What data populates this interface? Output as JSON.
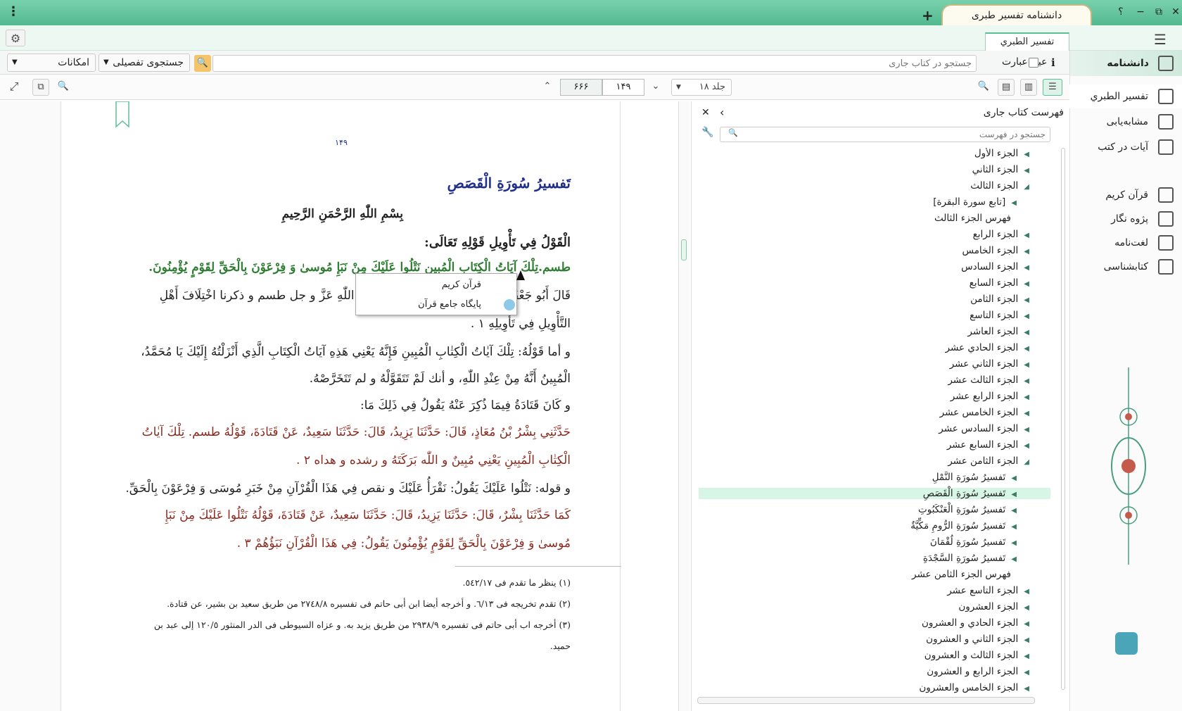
{
  "titlebar": {
    "tab_title": "دانشنامه تفسیر طبری",
    "new_tab": "+",
    "help": "؟",
    "minimize": "−",
    "restore": "⧉",
    "close": "✕",
    "menu": "⋮"
  },
  "tabbar": {
    "book_tab": "تفسير الطبري"
  },
  "search": {
    "options_label": "امکانات",
    "detail_label": "جستجوی تفصیلی",
    "placeholder": "جستجو در کتاب جاری",
    "exact_label": "عین عبارت",
    "info": "i"
  },
  "toolbar": {
    "volume": "جلد ۱۸",
    "page": "۱۴۹",
    "total_pages": "۶۶۶"
  },
  "reader": {
    "page_number": "۱۴۹",
    "title": "تَفسيرُ سُورَةِ الْقَصَصِ",
    "basmala": "بِسْمِ اللّٰهِ الرَّحْمَنِ الرَّحِيمِ",
    "heading": "الْقَوْلُ فِي تَأْوِيلِ قَوْلِهِ تَعَالَى:",
    "lines": [
      "طسم.تِلْكَ آيَاتُ الْكِتَابِ الْمُبِينِ نَتْلُوا عَلَيْكَ مِنْ نَبَإِ مُوسىٰ وَ فِرْعَوْنَ بِالْحَقِّ لِقَوْمٍ يُؤْمِنُونَ.",
      "قَالَ أَبُو جَعْفَرٍ: قَدْ مَضَى بَيَانُنَا فِي تَأْوِيلِ قَوْلِ اللّٰهِ عَزَّ و جل طسم و ذكرنا اخْتِلَافَ أَهْلِ",
      "التَّأْوِيلِ فِي تَأْوِيلِهِ ١ .",
      "و أما قَوْلُهُ: تِلْكَ آيٰاتُ الْكِتٰابِ الْمُبِينِ فَإِنَّهُ يَعْنِي هَذِهِ آيَاتُ الْكِتَابِ الَّذِي أَنْزَلْتُهُ إِلَيْكَ يَا مُحَمَّدُ،",
      "الْمُبِينُ أَنَّهُ مِنْ عِنْدِ اللّٰهِ، و أنك لَمْ تَتَقَوَّلْهُ و لم تَتَخَرَّصْهُ.",
      "و كَانَ قَتَادَةُ فِيمَا ذُكِرَ عَنْهُ يَقُولُ فِي ذَلِكَ مَا:",
      "حَدَّثَنِي بِشْرُ بْنُ مُعَاذٍ، قَالَ: حَدَّثَنَا يَزِيدُ، قَالَ: حَدَّثَنَا سَعِيدٌ، عَنْ قَتَادَةَ، قَوْلُهُ طسم. تِلْكَ آيٰاتُ",
      "الْكِتٰابِ الْمُبِينِ يَعْنِي مُبِينٌ و اللّٰه بَرَكَتَهُ و رشده و هداه ٢ .",
      "و قوله: نَتْلُوا عَلَيْكَ يَقُولُ: نَقْرَأُ عَلَيْكَ و نقص فِي هَذَا الْقُرْآنِ مِنْ خَبَرِ مُوسَى وَ فِرْعَوْنَ بِالْحَقِّ.",
      "كَمَا حَدَّثَنَا بِشْرٌ، قَالَ: حَدَّثَنَا يَزِيدُ، قَالَ: حَدَّثَنَا سَعِيدٌ، عَنْ قَتَادَةَ، قَوْلُهُ نَتْلُوا عَلَيْكَ مِنْ نَبَإِ",
      "مُوسىٰ وَ فِرْعَوْنَ بِالْحَقِّ لِقَوْمٍ يُؤْمِنُونَ يَقُولُ: فِي هَذَا الْقُرْآنِ نَبَؤُهُمْ ٣ ."
    ],
    "footnotes": [
      "(١)  ينظر ما تقدم فى ٥٤٢/١٧.",
      "(٢)  تقدم تخريجه فى ٦/١٣. و أخرجه أيضا ابن أبى حاتم فى تفسيره ٢٧٤٨/٨ من طريق سعيد بن بشير، عن قتادة.",
      "(٣)  أخرجه اب أبى حاتم فى تفسيره ٢٩٣٨/٩ من طريق يزيد به. و عزاه السيوطى فى الدر المنثور ١٢٠/٥ إلى عبد بن",
      "حميد."
    ]
  },
  "popup": {
    "items": [
      "قرآن كريم",
      "پايگاه جامع قرآن"
    ]
  },
  "toc": {
    "title": "فهرست كتاب جاری",
    "search_placeholder": "جستجو در فهرست",
    "items": [
      {
        "label": "الجزء الأول",
        "level": 0,
        "arrow": "◀"
      },
      {
        "label": "الجزء الثاني",
        "level": 0,
        "arrow": "◀"
      },
      {
        "label": "الجزء الثالث",
        "level": 0,
        "arrow": "◢"
      },
      {
        "label": "[تابع سورة البقرة]",
        "level": 1,
        "arrow": "◀"
      },
      {
        "label": "فهرس الجزء الثالث",
        "level": 1,
        "arrow": ""
      },
      {
        "label": "الجزء الرابع",
        "level": 0,
        "arrow": "◀"
      },
      {
        "label": "الجزء الخامس",
        "level": 0,
        "arrow": "◀"
      },
      {
        "label": "الجزء السادس",
        "level": 0,
        "arrow": "◀"
      },
      {
        "label": "الجزء السابع",
        "level": 0,
        "arrow": "◀"
      },
      {
        "label": "الجزء الثامن",
        "level": 0,
        "arrow": "◀"
      },
      {
        "label": "الجزء التاسع",
        "level": 0,
        "arrow": "◀"
      },
      {
        "label": "الجزء العاشر",
        "level": 0,
        "arrow": "◀"
      },
      {
        "label": "الجزء الحادي عشر",
        "level": 0,
        "arrow": "◀"
      },
      {
        "label": "الجزء الثاني عشر",
        "level": 0,
        "arrow": "◀"
      },
      {
        "label": "الجزء الثالث عشر",
        "level": 0,
        "arrow": "◀"
      },
      {
        "label": "الجزء الرابع عشر",
        "level": 0,
        "arrow": "◀"
      },
      {
        "label": "الجزء الخامس عشر",
        "level": 0,
        "arrow": "◀"
      },
      {
        "label": "الجزء السادس عشر",
        "level": 0,
        "arrow": "◀"
      },
      {
        "label": "الجزء السابع عشر",
        "level": 0,
        "arrow": "◀"
      },
      {
        "label": "الجزء الثامن عشر",
        "level": 0,
        "arrow": "◢"
      },
      {
        "label": "تَفسيرُ سُورَةِ النَّمْلِ",
        "level": 1,
        "arrow": "◀"
      },
      {
        "label": "تَفسيرُ سُورَةِ الْقَصَصِ",
        "level": 1,
        "arrow": "◀",
        "selected": true
      },
      {
        "label": "تَفسيرُ سُورَةِ الْعَنْكَبُوتِ",
        "level": 1,
        "arrow": "◀"
      },
      {
        "label": "تَفسيرُ سُورَةِ الرُّومِ مَكِّيَّةٌ",
        "level": 1,
        "arrow": "◀"
      },
      {
        "label": "تَفسيرُ سُورَةِ لُقْمَانَ",
        "level": 1,
        "arrow": "◀"
      },
      {
        "label": "تَفسيرُ سُورَةِ السَّجْدَةِ",
        "level": 1,
        "arrow": "◀"
      },
      {
        "label": "فهرس الجزء الثامن عشر",
        "level": 1,
        "arrow": ""
      },
      {
        "label": "الجزء التاسع عشر",
        "level": 0,
        "arrow": "◀"
      },
      {
        "label": "الجزء العشرون",
        "level": 0,
        "arrow": "◀"
      },
      {
        "label": "الجزء الحادي و العشرون",
        "level": 0,
        "arrow": "◀"
      },
      {
        "label": "الجزء الثاني و العشرون",
        "level": 0,
        "arrow": "◀"
      },
      {
        "label": "الجزء الثالث و العشرون",
        "level": 0,
        "arrow": "◀"
      },
      {
        "label": "الجزء الرابع و العشرون",
        "level": 0,
        "arrow": "◀"
      },
      {
        "label": "الجزء الخامس والعشرون",
        "level": 0,
        "arrow": "◀"
      }
    ]
  },
  "sidebar": {
    "header": "دانشنامه",
    "items": [
      {
        "label": "تفسير الطبري",
        "icon": "books-icon"
      },
      {
        "label": "مشابه‌یابی",
        "icon": "compare-icon"
      },
      {
        "label": "آیات در کتب",
        "icon": "verses-icon"
      }
    ],
    "tools": [
      {
        "label": "قرآن کریم",
        "icon": "quran-icon"
      },
      {
        "label": "پژوه نگار",
        "icon": "notes-icon"
      },
      {
        "label": "لغت‌نامه",
        "icon": "dictionary-icon"
      },
      {
        "label": "کتابشناسی",
        "icon": "info-icon"
      }
    ]
  },
  "colors": {
    "accent": "#5bbf96",
    "title_blue": "#1f2f8a",
    "verse_green": "#2e7d32",
    "hadith_red": "#8b2a1f",
    "selected_row": "#d8f6e6"
  }
}
